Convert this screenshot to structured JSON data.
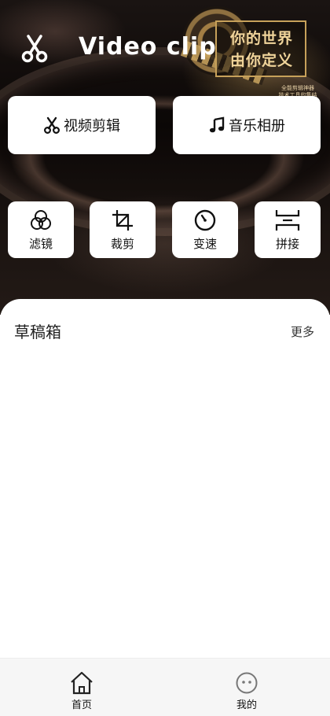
{
  "header": {
    "title": "Video clip",
    "banner_lines": [
      "你的世界",
      "由你定义"
    ],
    "banner_note": [
      "全能剪辑神器",
      "技术工具的集结"
    ]
  },
  "quick_actions": [
    {
      "label": "视频剪辑",
      "icon": "scissors-icon"
    },
    {
      "label": "音乐相册",
      "icon": "music-note-icon"
    }
  ],
  "tools": [
    {
      "label": "滤镜",
      "icon": "filter-icon"
    },
    {
      "label": "裁剪",
      "icon": "crop-icon"
    },
    {
      "label": "变速",
      "icon": "speed-dial-icon"
    },
    {
      "label": "拼接",
      "icon": "splice-icon"
    }
  ],
  "drafts": {
    "title": "草稿箱",
    "more_label": "更多"
  },
  "bottom_nav": [
    {
      "label": "首页",
      "icon": "home-icon"
    },
    {
      "label": "我的",
      "icon": "profile-face-icon"
    }
  ],
  "colors": {
    "hero_dark": "#0b0706",
    "gold": "#c7a15a",
    "card": "#ffffff",
    "nav_bg": "#f6f6f6"
  }
}
